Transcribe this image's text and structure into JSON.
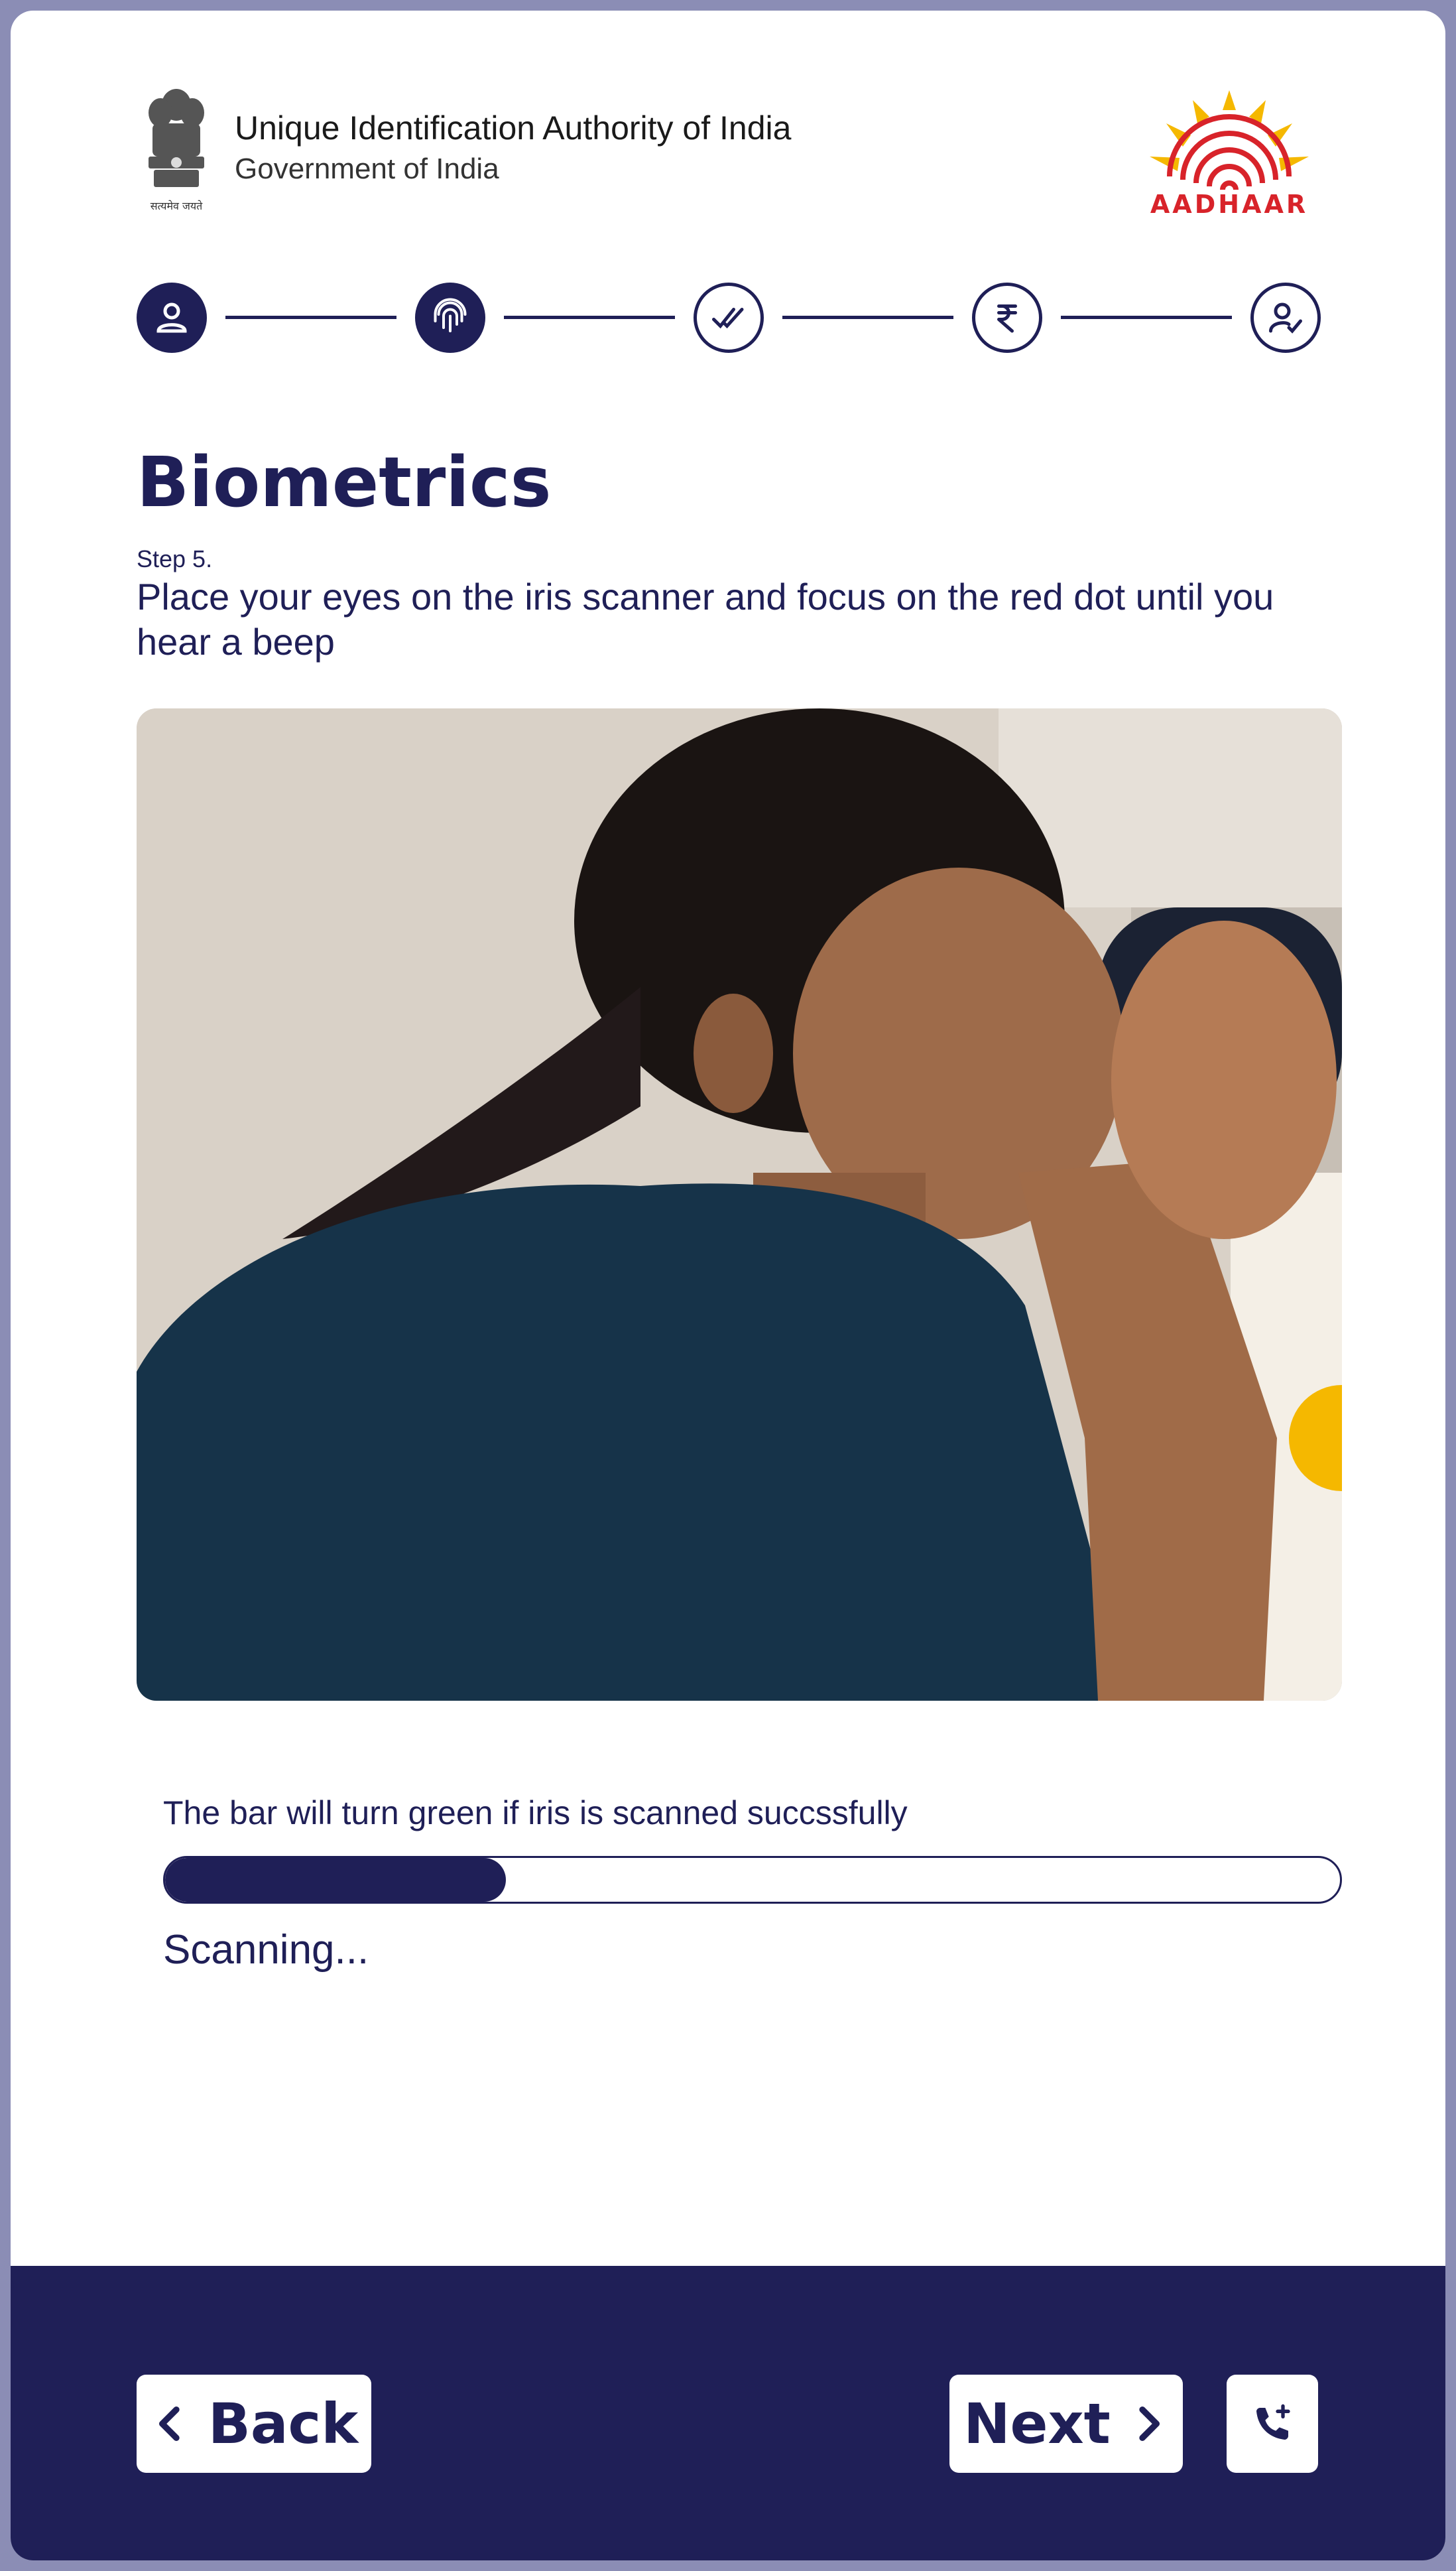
{
  "header": {
    "org_name": "Unique Identification Authority of India",
    "org_sub": "Government of India",
    "emblem_motto": "सत्यमेव जयते",
    "logo_text": "AADHAAR"
  },
  "stepper": {
    "steps": [
      {
        "icon": "user-icon",
        "state": "done"
      },
      {
        "icon": "fingerprint-icon",
        "state": "current"
      },
      {
        "icon": "double-check-icon",
        "state": "todo"
      },
      {
        "icon": "rupee-icon",
        "state": "todo"
      },
      {
        "icon": "user-check-icon",
        "state": "todo"
      }
    ]
  },
  "content": {
    "title": "Biometrics",
    "step_label": "Step 5.",
    "instruction": "Place your eyes on the iris scanner and focus on the red dot until you hear a beep",
    "bar_caption": "The bar will turn green if iris is scanned succssfully",
    "progress": 0.29,
    "status": "Scanning..."
  },
  "footer": {
    "back_label": "Back",
    "next_label": "Next",
    "call_icon": "phone-add-icon"
  },
  "colors": {
    "primary": "#1f1f57",
    "background": "#ffffff",
    "frame": "#8b8db5",
    "brand_red": "#d8232a",
    "brand_yellow": "#f5b800"
  }
}
